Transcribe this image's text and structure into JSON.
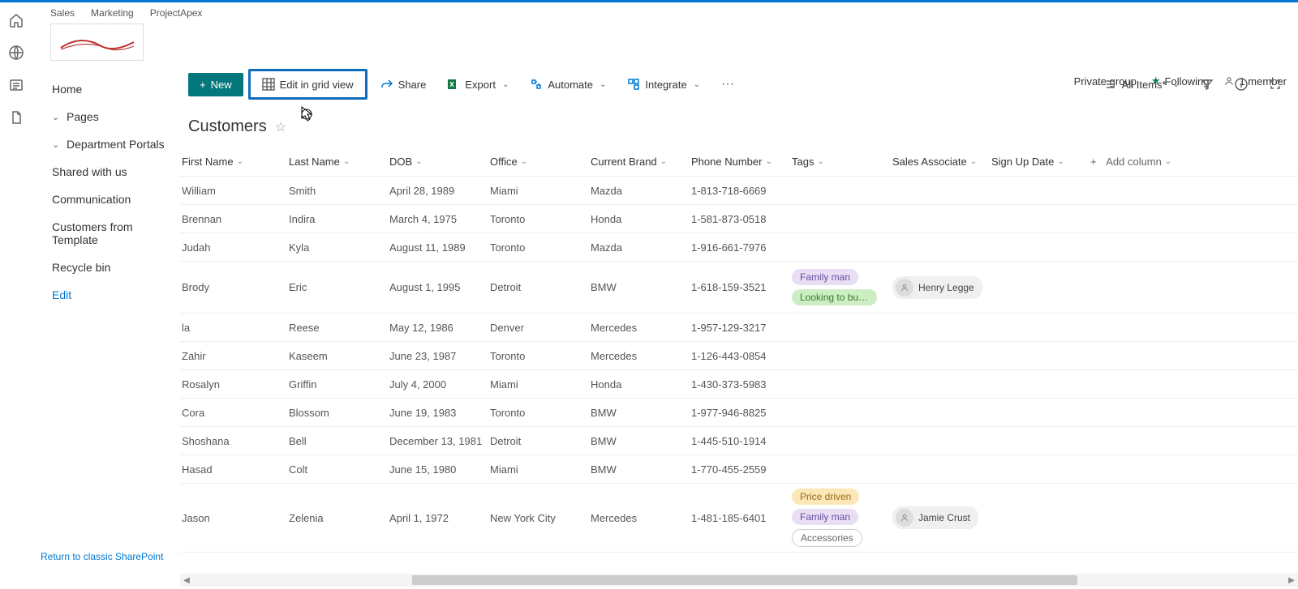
{
  "breadcrumb": [
    "Sales",
    "Marketing",
    "ProjectApex"
  ],
  "group_info": {
    "private": "Private group",
    "following": "Following",
    "members": "1 member"
  },
  "sidebar": {
    "home": "Home",
    "pages": "Pages",
    "dept": "Department Portals",
    "shared": "Shared with us",
    "comm": "Communication",
    "cust_tpl": "Customers from Template",
    "recycle": "Recycle bin",
    "edit": "Edit",
    "return_link": "Return to classic SharePoint"
  },
  "commands": {
    "new": "New",
    "edit_grid": "Edit in grid view",
    "share": "Share",
    "export": "Export",
    "automate": "Automate",
    "integrate": "Integrate",
    "all_items": "All Items*",
    "add_column": "Add column"
  },
  "list_title": "Customers",
  "columns": {
    "first": "First Name",
    "last": "Last Name",
    "dob": "DOB",
    "office": "Office",
    "brand": "Current Brand",
    "phone": "Phone Number",
    "tags": "Tags",
    "assoc": "Sales Associate",
    "signup": "Sign Up Date"
  },
  "rows": [
    {
      "first": "William",
      "last": "Smith",
      "dob": "April 28, 1989",
      "office": "Miami",
      "brand": "Mazda",
      "phone": "1-813-718-6669",
      "tags": [],
      "assoc": ""
    },
    {
      "first": "Brennan",
      "last": "Indira",
      "dob": "March 4, 1975",
      "office": "Toronto",
      "brand": "Honda",
      "phone": "1-581-873-0518",
      "tags": [],
      "assoc": ""
    },
    {
      "first": "Judah",
      "last": "Kyla",
      "dob": "August 11, 1989",
      "office": "Toronto",
      "brand": "Mazda",
      "phone": "1-916-661-7976",
      "tags": [],
      "assoc": ""
    },
    {
      "first": "Brody",
      "last": "Eric",
      "dob": "August 1, 1995",
      "office": "Detroit",
      "brand": "BMW",
      "phone": "1-618-159-3521",
      "tags": [
        {
          "t": "Family man",
          "c": "purple"
        },
        {
          "t": "Looking to buy s...",
          "c": "green"
        }
      ],
      "assoc": "Henry Legge"
    },
    {
      "first": "la",
      "last": "Reese",
      "dob": "May 12, 1986",
      "office": "Denver",
      "brand": "Mercedes",
      "phone": "1-957-129-3217",
      "tags": [],
      "assoc": ""
    },
    {
      "first": "Zahir",
      "last": "Kaseem",
      "dob": "June 23, 1987",
      "office": "Toronto",
      "brand": "Mercedes",
      "phone": "1-126-443-0854",
      "tags": [],
      "assoc": ""
    },
    {
      "first": "Rosalyn",
      "last": "Griffin",
      "dob": "July 4, 2000",
      "office": "Miami",
      "brand": "Honda",
      "phone": "1-430-373-5983",
      "tags": [],
      "assoc": ""
    },
    {
      "first": "Cora",
      "last": "Blossom",
      "dob": "June 19, 1983",
      "office": "Toronto",
      "brand": "BMW",
      "phone": "1-977-946-8825",
      "tags": [],
      "assoc": ""
    },
    {
      "first": "Shoshana",
      "last": "Bell",
      "dob": "December 13, 1981",
      "office": "Detroit",
      "brand": "BMW",
      "phone": "1-445-510-1914",
      "tags": [],
      "assoc": ""
    },
    {
      "first": "Hasad",
      "last": "Colt",
      "dob": "June 15, 1980",
      "office": "Miami",
      "brand": "BMW",
      "phone": "1-770-455-2559",
      "tags": [],
      "assoc": ""
    },
    {
      "first": "Jason",
      "last": "Zelenia",
      "dob": "April 1, 1972",
      "office": "New York City",
      "brand": "Mercedes",
      "phone": "1-481-185-6401",
      "tags": [
        {
          "t": "Price driven",
          "c": "yellow"
        },
        {
          "t": "Family man",
          "c": "purple"
        },
        {
          "t": "Accessories",
          "c": "outline"
        }
      ],
      "assoc": "Jamie Crust"
    }
  ]
}
